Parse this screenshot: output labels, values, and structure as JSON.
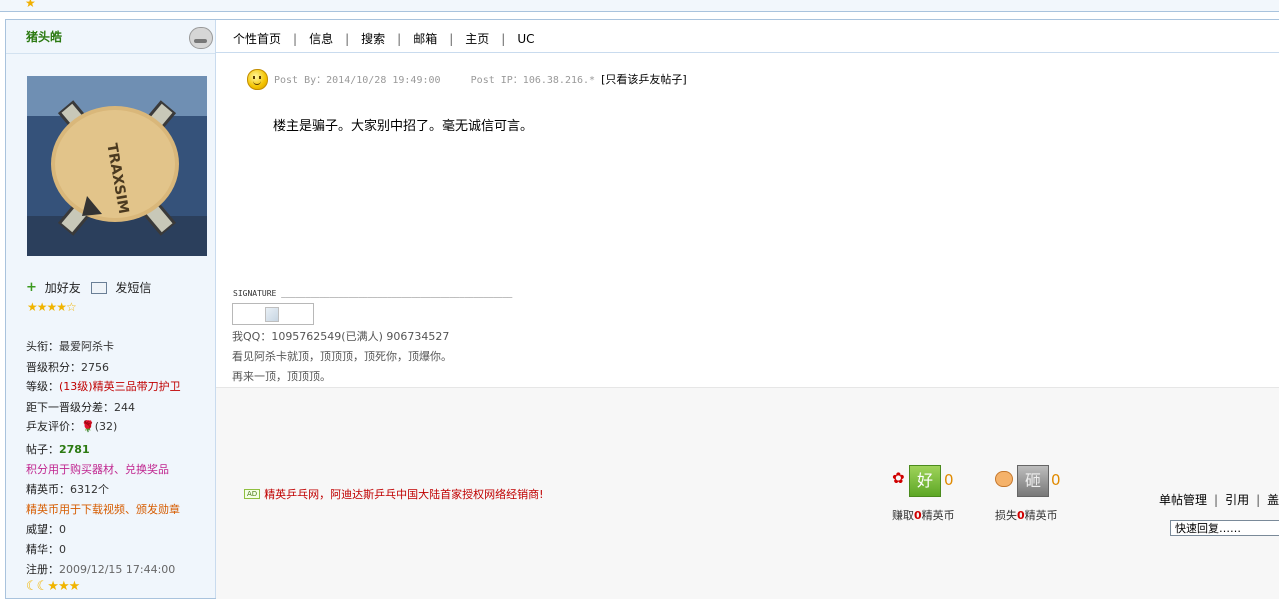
{
  "top": {
    "star": "★"
  },
  "user": {
    "name": "猪头皓",
    "add_friend": "加好友",
    "send_message": "发短信",
    "stars": "★★★★☆",
    "title_label": "头衔：",
    "title_value": "最爱阿杀卡",
    "promote_points_label": "晋级积分：",
    "promote_points_value": "2756",
    "level_label": "等级：",
    "level_value": "(13级)精英三品带刀护卫",
    "next_level_label": "距下一晋级分差：",
    "next_level_value": "244",
    "rating_label": "乒友评价：",
    "rating_icon": "🌹",
    "rating_value": "(32)",
    "posts_label": "帖子：",
    "posts_value": "2781",
    "points_note": "积分用于购买器材、兑换奖品",
    "coins_label": "精英币：",
    "coins_value": "6312个",
    "coins_note": "精英币用于下载视频、颁发勋章",
    "prestige_label": "威望：",
    "prestige_value": "0",
    "essence_label": "精华：",
    "essence_value": "0",
    "register_label": "注册：",
    "register_value": "2009/12/15 17:44:00",
    "moons": "☾☾★★★"
  },
  "nav": {
    "items": [
      "个性首页",
      "信息",
      "搜索",
      "邮箱",
      "主页",
      "UC"
    ],
    "separator": "|"
  },
  "post": {
    "post_by": "Post By：2014/10/28 19:49:00",
    "post_ip": "Post IP：106.38.216.*",
    "only_this_user": "[只看该乒友帖子]",
    "body": "楼主是骗子。大家别中招了。毫无诚信可言。"
  },
  "signature": {
    "label": "SIGNATURE ________________________________________________",
    "qq_line": "我QQ：1095762549(已满人)        906734527",
    "line2": "看见阿杀卡就顶，顶顶顶，顶死你，顶爆你。",
    "line3": "再来一顶，顶顶顶。"
  },
  "footer": {
    "ad_badge": "AD",
    "ad_text": "精英乒乓网，阿迪达斯乒乓中国大陆首家授权网络经销商!",
    "good_label": "好",
    "good_count": "0",
    "good_caption_pre": "赚取",
    "good_caption_num": "0",
    "good_caption_post": "精英币",
    "bad_label": "砸",
    "bad_count": "0",
    "bad_caption_pre": "损失",
    "bad_caption_num": "0",
    "bad_caption_post": "精英币",
    "manage": "单帖管理",
    "quote": "引用",
    "more": "盖",
    "separator": "|",
    "quick_reply": "快速回复……"
  }
}
